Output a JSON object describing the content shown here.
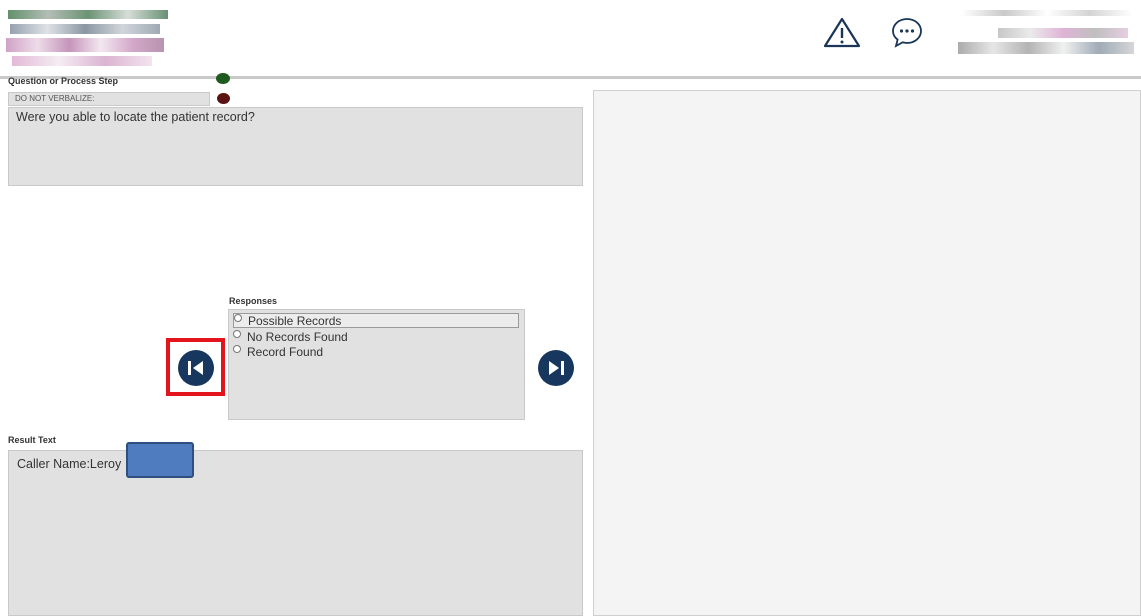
{
  "header": {
    "icons": [
      "warning-icon",
      "chat-bubble-icon"
    ]
  },
  "question": {
    "section_label": "Question or Process Step",
    "do_not_verbalize": "DO NOT VERBALIZE:",
    "text": "Were you able to locate the patient record?",
    "status_colors": [
      "#1e5a1e",
      "#5a1212"
    ]
  },
  "responses": {
    "label": "Responses",
    "items": [
      {
        "label": "Possible Records",
        "highlighted": true
      },
      {
        "label": "No Records Found",
        "highlighted": false
      },
      {
        "label": "Record Found",
        "highlighted": false
      }
    ]
  },
  "navigation": {
    "back_icon": "skip-back-icon",
    "forward_icon": "skip-forward-icon",
    "accent": "#17375e",
    "highlight_color": "#e3141b"
  },
  "result": {
    "label": "Result Text",
    "text": "Caller Name:Leroy"
  }
}
